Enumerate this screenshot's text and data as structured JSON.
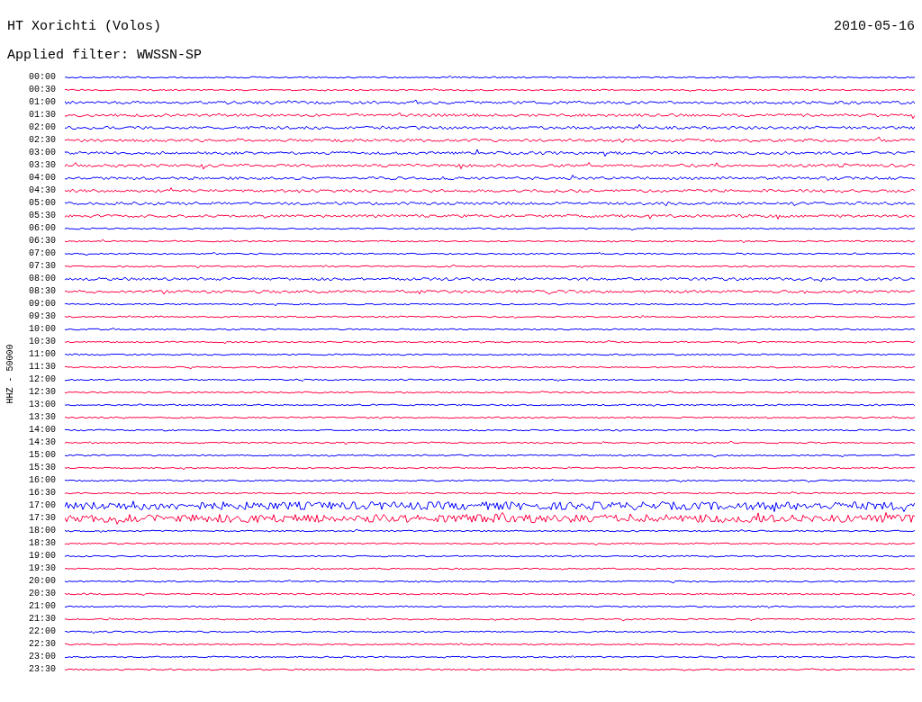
{
  "header": {
    "station": "HT Xorichti (Volos)",
    "date": "2010-05-16",
    "filter": "Applied filter: WWSSN-SP"
  },
  "axis_label": "HHZ - 50000",
  "rows": [
    {
      "time": "00:00",
      "color": "#0000ff"
    },
    {
      "time": "00:30",
      "color": "#ff0040"
    },
    {
      "time": "01:00",
      "color": "#0000ff"
    },
    {
      "time": "01:30",
      "color": "#ff0040"
    },
    {
      "time": "02:00",
      "color": "#0000ff"
    },
    {
      "time": "02:30",
      "color": "#ff0040"
    },
    {
      "time": "03:00",
      "color": "#0000ff"
    },
    {
      "time": "03:30",
      "color": "#ff0040"
    },
    {
      "time": "04:00",
      "color": "#0000ff"
    },
    {
      "time": "04:30",
      "color": "#ff0040"
    },
    {
      "time": "05:00",
      "color": "#0000ff"
    },
    {
      "time": "05:30",
      "color": "#ff0040"
    },
    {
      "time": "06:00",
      "color": "#0000ff"
    },
    {
      "time": "06:30",
      "color": "#ff0040"
    },
    {
      "time": "07:00",
      "color": "#0000ff"
    },
    {
      "time": "07:30",
      "color": "#ff0040"
    },
    {
      "time": "08:00",
      "color": "#0000ff"
    },
    {
      "time": "08:30",
      "color": "#ff0040"
    },
    {
      "time": "09:00",
      "color": "#0000ff"
    },
    {
      "time": "09:30",
      "color": "#ff0040"
    },
    {
      "time": "10:00",
      "color": "#0000ff"
    },
    {
      "time": "10:30",
      "color": "#ff0040"
    },
    {
      "time": "11:00",
      "color": "#0000ff"
    },
    {
      "time": "11:30",
      "color": "#ff0040"
    },
    {
      "time": "12:00",
      "color": "#0000ff"
    },
    {
      "time": "12:30",
      "color": "#ff0040"
    },
    {
      "time": "13:00",
      "color": "#0000ff"
    },
    {
      "time": "13:30",
      "color": "#ff0040"
    },
    {
      "time": "14:00",
      "color": "#0000ff"
    },
    {
      "time": "14:30",
      "color": "#ff0040"
    },
    {
      "time": "15:00",
      "color": "#0000ff"
    },
    {
      "time": "15:30",
      "color": "#ff0040"
    },
    {
      "time": "16:00",
      "color": "#0000ff"
    },
    {
      "time": "16:30",
      "color": "#ff0040"
    },
    {
      "time": "17:00",
      "color": "#0000ff"
    },
    {
      "time": "17:30",
      "color": "#ff0040"
    },
    {
      "time": "18:00",
      "color": "#0000ff"
    },
    {
      "time": "18:30",
      "color": "#ff0040"
    },
    {
      "time": "19:00",
      "color": "#0000ff"
    },
    {
      "time": "19:30",
      "color": "#ff0040"
    },
    {
      "time": "20:00",
      "color": "#0000ff"
    },
    {
      "time": "20:30",
      "color": "#ff0040"
    },
    {
      "time": "21:00",
      "color": "#0000ff"
    },
    {
      "time": "21:30",
      "color": "#ff0040"
    },
    {
      "time": "22:00",
      "color": "#0000ff"
    },
    {
      "time": "22:30",
      "color": "#ff0040"
    },
    {
      "time": "23:00",
      "color": "#0000ff"
    },
    {
      "time": "23:30",
      "color": "#ff0040"
    }
  ]
}
